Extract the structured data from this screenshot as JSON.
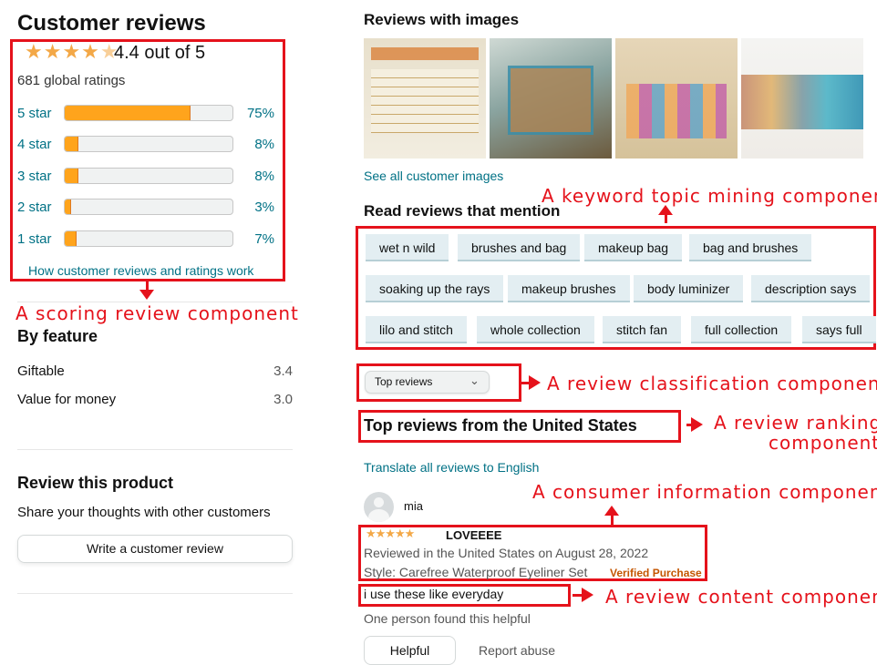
{
  "summary": {
    "title": "Customer reviews",
    "rating_text": "4.4 out of 5",
    "rating_value": 4.4,
    "global_ratings": "681 global ratings",
    "histogram": [
      {
        "label": "5 star",
        "pct_text": "75%",
        "fraction": 0.75
      },
      {
        "label": "4 star",
        "pct_text": "8%",
        "fraction": 0.08
      },
      {
        "label": "3 star",
        "pct_text": "8%",
        "fraction": 0.08
      },
      {
        "label": "2 star",
        "pct_text": "3%",
        "fraction": 0.03
      },
      {
        "label": "1 star",
        "pct_text": "7%",
        "fraction": 0.07
      }
    ],
    "how_link": "How customer reviews and ratings work"
  },
  "feature": {
    "title": "By feature",
    "items": [
      {
        "name": "Giftable",
        "score": "3.4"
      },
      {
        "name": "Value for money",
        "score": "3.0"
      }
    ]
  },
  "review_product": {
    "title": "Review this product",
    "subtitle": "Share your thoughts with other customers",
    "button": "Write a customer review"
  },
  "images": {
    "title": "Reviews with images",
    "see_all": "See all customer images"
  },
  "mention": {
    "title": "Read reviews that mention",
    "chips": [
      "wet n wild",
      "brushes and bag",
      "makeup bag",
      "bag and brushes",
      "soaking up the rays",
      "makeup brushes",
      "body luminizer",
      "description says",
      "lilo and stitch",
      "whole collection",
      "stitch fan",
      "full collection",
      "says full"
    ]
  },
  "sort": {
    "selected": "Top reviews"
  },
  "top_reviews": {
    "title": "Top reviews from the United States",
    "translate_link": "Translate all reviews to English"
  },
  "review": {
    "author": "mia",
    "stars": 5,
    "headline": "LOVEEEE",
    "date_line": "Reviewed in the United States on August 28, 2022",
    "style_line": "Style: Carefree Waterproof Eyeliner Set",
    "verified": "Verified Purchase",
    "body": "i use these like everyday",
    "helpful_count": "One person found this helpful",
    "helpful_button": "Helpful",
    "report": "Report abuse"
  },
  "annotations": {
    "scoring": "A scoring review component",
    "keyword": "A keyword topic mining component",
    "classification": "A review classification component",
    "ranking_line1": "A review ranking",
    "ranking_line2": "component",
    "consumer": "A consumer information component",
    "content": "A review content component"
  },
  "colors": {
    "annotation_red": "#e5121b",
    "star_orange": "#ffa41c",
    "link_teal": "#007185",
    "verified_orange": "#c45500"
  }
}
